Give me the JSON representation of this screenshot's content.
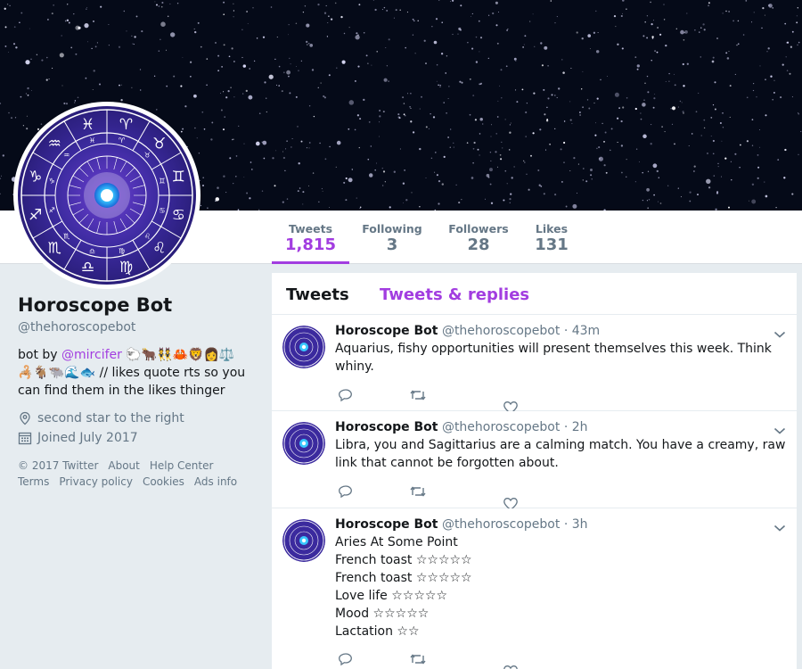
{
  "colors": {
    "accent": "#a23de0",
    "muted": "#657786",
    "text": "#14171a",
    "page": "#e6ecf0"
  },
  "stats": [
    {
      "label": "Tweets",
      "value": "1,815"
    },
    {
      "label": "Following",
      "value": "3"
    },
    {
      "label": "Followers",
      "value": "28"
    },
    {
      "label": "Likes",
      "value": "131"
    }
  ],
  "profile": {
    "name": "Horoscope Bot",
    "handle": "@thehoroscopebot",
    "bio_prefix": "bot by ",
    "bio_link": "@mircifer",
    "bio_emoji_line1": " 🐑🐂👯🦀🦁👩⚖️",
    "bio_emoji_line2": "🦂🐐🐃🌊🐟",
    "bio_suffix": " // likes quote rts so you can find them in the likes thinger",
    "location": "second star to the right",
    "joined": "Joined July 2017",
    "location_icon": "location-pin-icon",
    "calendar_icon": "calendar-icon"
  },
  "footer": {
    "row1": [
      "© 2017 Twitter",
      "About",
      "Help Center"
    ],
    "row2": [
      "Terms",
      "Privacy policy",
      "Cookies",
      "Ads info"
    ]
  },
  "tabs": {
    "tweets": "Tweets",
    "replies": "Tweets & replies"
  },
  "tweets": [
    {
      "name": "Horoscope Bot",
      "handle": "@thehoroscopebot",
      "time": " · 43m",
      "lines": [
        "Aquarius, fishy opportunities will present themselves this week. Think whiny."
      ]
    },
    {
      "name": "Horoscope Bot",
      "handle": "@thehoroscopebot",
      "time": " · 2h",
      "lines": [
        "Libra, you and Sagittarius are a calming match. You have a creamy, raw link that cannot be forgotten about."
      ]
    },
    {
      "name": "Horoscope Bot",
      "handle": "@thehoroscopebot",
      "time": " · 3h",
      "lines": [
        "Aries At Some Point",
        "French toast ☆☆☆☆☆",
        "French toast ☆☆☆☆☆",
        "Love life ☆☆☆☆☆",
        "Mood ☆☆☆☆☆",
        "Lactation ☆☆"
      ]
    }
  ]
}
